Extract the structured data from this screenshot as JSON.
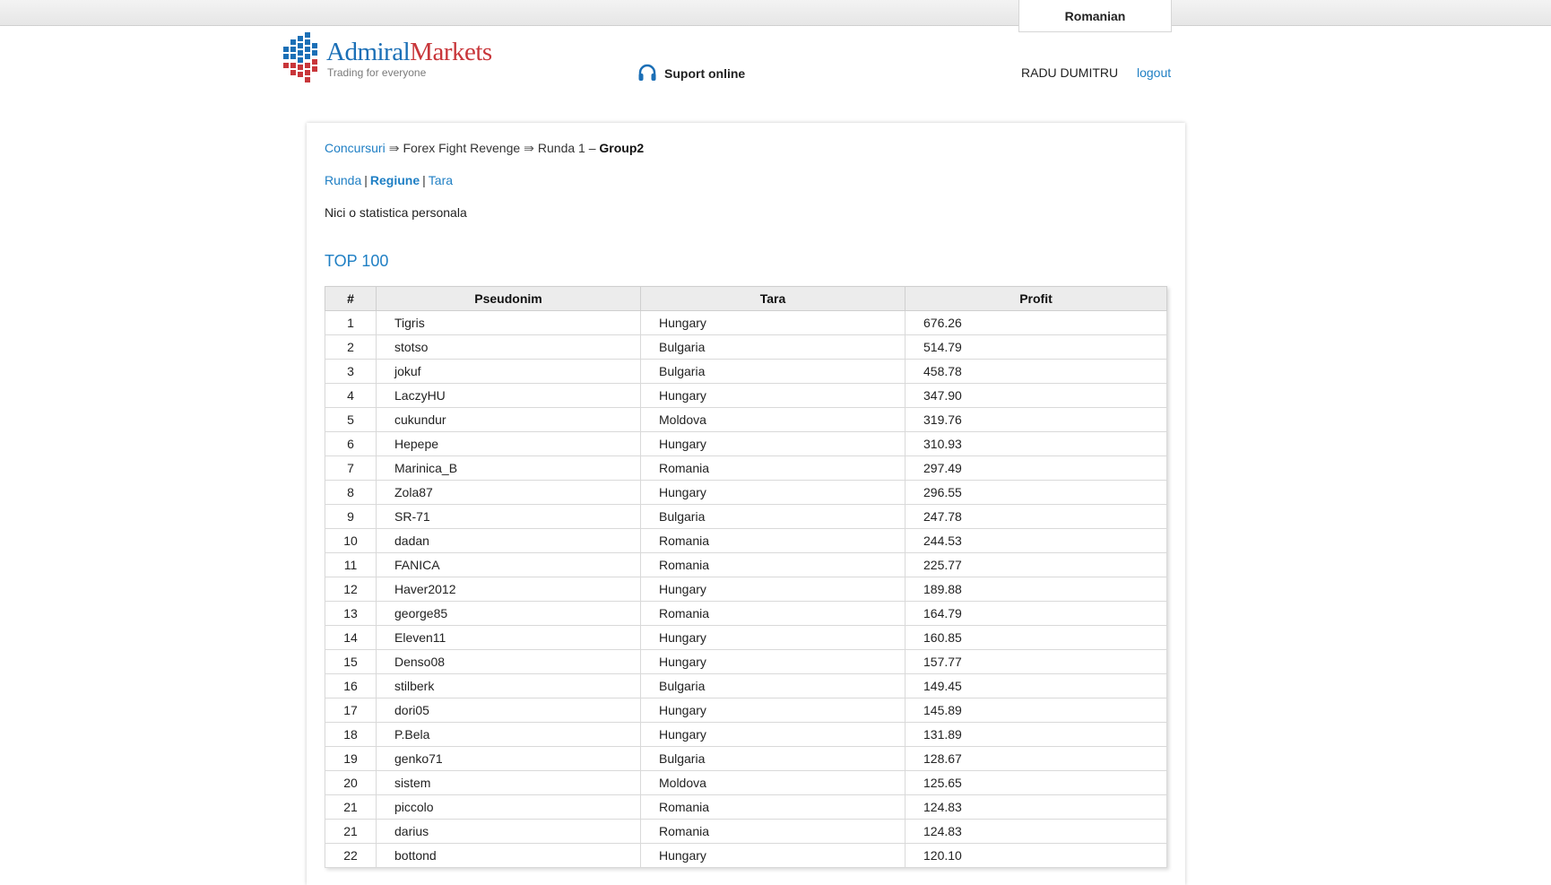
{
  "header": {
    "language": "Romanian",
    "logo": {
      "part1": "Admiral",
      "part2": "Markets",
      "tagline": "Trading for everyone"
    },
    "support_label": "Suport online",
    "user_name": "RADU DUMITRU",
    "logout_label": "logout",
    "colors": {
      "brand_blue": "#1b6fb6",
      "brand_red": "#c8363a",
      "link": "#1f7fc4"
    }
  },
  "breadcrumb": {
    "root": "Concursuri",
    "arrow": "⇛",
    "contest": "Forex Fight Revenge",
    "round": "Runda 1 –",
    "group": "Group2"
  },
  "subnav": {
    "items": [
      "Runda",
      "Regiune",
      "Tara"
    ],
    "active": "Regiune"
  },
  "personal_stats": "Nici o statistica personala",
  "top_title": "TOP 100",
  "table": {
    "headers": [
      "#",
      "Pseudonim",
      "Tara",
      "Profit"
    ],
    "rows": [
      [
        "1",
        "Tigris",
        "Hungary",
        "676.26"
      ],
      [
        "2",
        "stotso",
        "Bulgaria",
        "514.79"
      ],
      [
        "3",
        "jokuf",
        "Bulgaria",
        "458.78"
      ],
      [
        "4",
        "LaczyHU",
        "Hungary",
        "347.90"
      ],
      [
        "5",
        "cukundur",
        "Moldova",
        "319.76"
      ],
      [
        "6",
        "Hepepe",
        "Hungary",
        "310.93"
      ],
      [
        "7",
        "Marinica_B",
        "Romania",
        "297.49"
      ],
      [
        "8",
        "Zola87",
        "Hungary",
        "296.55"
      ],
      [
        "9",
        "SR-71",
        "Bulgaria",
        "247.78"
      ],
      [
        "10",
        "dadan",
        "Romania",
        "244.53"
      ],
      [
        "11",
        "FANICA",
        "Romania",
        "225.77"
      ],
      [
        "12",
        "Haver2012",
        "Hungary",
        "189.88"
      ],
      [
        "13",
        "george85",
        "Romania",
        "164.79"
      ],
      [
        "14",
        "Eleven11",
        "Hungary",
        "160.85"
      ],
      [
        "15",
        "Denso08",
        "Hungary",
        "157.77"
      ],
      [
        "16",
        "stilberk",
        "Bulgaria",
        "149.45"
      ],
      [
        "17",
        "dori05",
        "Hungary",
        "145.89"
      ],
      [
        "18",
        "P.Bela",
        "Hungary",
        "131.89"
      ],
      [
        "19",
        "genko71",
        "Bulgaria",
        "128.67"
      ],
      [
        "20",
        "sistem",
        "Moldova",
        "125.65"
      ],
      [
        "21",
        "piccolo",
        "Romania",
        "124.83"
      ],
      [
        "21",
        "darius",
        "Romania",
        "124.83"
      ],
      [
        "22",
        "bottond",
        "Hungary",
        "120.10"
      ]
    ]
  }
}
